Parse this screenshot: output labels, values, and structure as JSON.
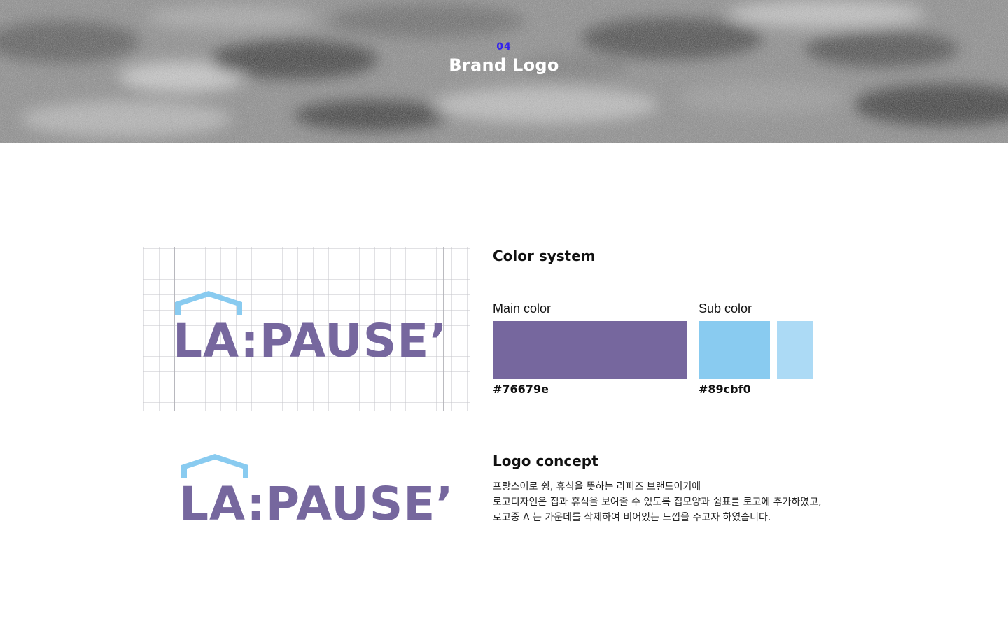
{
  "hero": {
    "section_number": "04",
    "section_title": "Brand Logo"
  },
  "logo": {
    "wordmark": "LA:PAUSE’",
    "brand_color": "#76679e",
    "roof_color": "#89cbf0"
  },
  "color_system": {
    "heading": "Color system",
    "main": {
      "label": "Main color",
      "hex": "#76679e",
      "color": "#76679e"
    },
    "sub": {
      "label": "Sub color",
      "hex": "#89cbf0",
      "color": "#89cbf0",
      "tint_color": "#acdaf5"
    }
  },
  "logo_concept": {
    "heading": "Logo concept",
    "lines": [
      "프랑스어로 쉼, 휴식을 뜻하는 라퍼즈 브랜드이기에",
      "로고디자인은 집과 휴식을 보여줄 수 있도록 집모양과 쉼표를 로고에 추가하였고,",
      "로고중 A 는 가운데를 삭제하여 비어있는 느낌을 주고자 하였습니다."
    ]
  }
}
